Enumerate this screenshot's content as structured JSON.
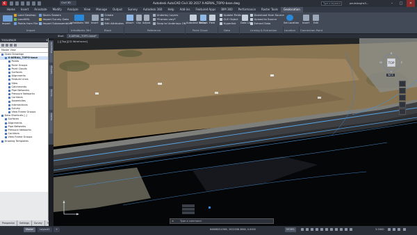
{
  "title_bar": {
    "app_icon_letter": "C",
    "workspace": "Civil 3D",
    "window_title": "Autodesk AutoCAD Civil 3D 2017    X-AERIAL_TOPO-base.dwg",
    "search_placeholder": "Type a keyword",
    "user_name": "paulslaughs3...",
    "minimize": "–",
    "maximize": "□",
    "close": "✕"
  },
  "ribbon_tabs": [
    "Home",
    "Insert",
    "Annotate",
    "Modify",
    "Analyze",
    "View",
    "Manage",
    "Output",
    "Survey",
    "Autodesk 360",
    "Help",
    "Add-ins",
    "Featured Apps",
    "BIM 360",
    "Performance",
    "Raster Tools",
    "Geolocation"
  ],
  "active_tab": "Geolocation",
  "ribbon": {
    "import_label": "Import",
    "import_items": [
      "Land Desktop",
      "LandXML",
      "Points from File"
    ],
    "import_items_2": [
      "Storm Sewers",
      "Import Survey Data",
      "Import Subassemblies"
    ],
    "infraworks_label": "InfraWorks 360",
    "insert_label": "Insert",
    "block_items": [
      "Create",
      "Edit",
      "Edit Attributes"
    ],
    "reference_items": [
      "Attach",
      "Clip",
      "Adjust"
    ],
    "reference_items_2": [
      "Underlay Layers",
      "*Frames vary*",
      "Snap to Underlays ON"
    ],
    "autodesk_recap_label": "Autodesk ReCap",
    "pointcloud_attach_label": "Attach",
    "pointcloud_field_label": "Field",
    "data_items": [
      "Update Fields",
      "OLE Object",
      "Hyperlink"
    ],
    "data_link_label": "Data Link",
    "linking_items": [
      "Download from Source",
      "Upload to Source",
      "Extract Data"
    ],
    "set_location_label": "Set Location",
    "connection_insert_label": "Insert",
    "connection_edit_label": "Edit",
    "panels": [
      "Import",
      "InfraWorks 360",
      "Block",
      "Reference",
      "Point Cloud",
      "Data",
      "Linking & Extraction",
      "Location",
      "Connection Point"
    ]
  },
  "doc_tabs": [
    "Start",
    "X-AERIAL_TOPO-base*"
  ],
  "active_doc": "X-AERIAL_TOPO-base*",
  "toolspace": {
    "title": "TOOLSPACE",
    "selector": "Master View",
    "tree": [
      {
        "label": "Open Drawings",
        "level": 0
      },
      {
        "label": "X-AERIAL_TOPO-base",
        "level": 1,
        "bold": true,
        "selected": true
      },
      {
        "label": "Points",
        "level": 2
      },
      {
        "label": "Point Groups",
        "level": 2
      },
      {
        "label": "Point Clouds",
        "level": 2
      },
      {
        "label": "Surfaces",
        "level": 2
      },
      {
        "label": "Alignments",
        "level": 2
      },
      {
        "label": "Feature Lines",
        "level": 2
      },
      {
        "label": "Sites",
        "level": 2
      },
      {
        "label": "Catchments",
        "level": 2
      },
      {
        "label": "Pipe Networks",
        "level": 2
      },
      {
        "label": "Pressure Networks",
        "level": 2
      },
      {
        "label": "Corridors",
        "level": 2
      },
      {
        "label": "Assemblies",
        "level": 2
      },
      {
        "label": "Intersections",
        "level": 2
      },
      {
        "label": "Survey",
        "level": 2
      },
      {
        "label": "View Frame Groups",
        "level": 2
      },
      {
        "label": "Data Shortcuts [-]",
        "level": 0
      },
      {
        "label": "Surfaces",
        "level": 1
      },
      {
        "label": "Alignments",
        "level": 1
      },
      {
        "label": "Pipe Networks",
        "level": 1
      },
      {
        "label": "Pressure Networks",
        "level": 1
      },
      {
        "label": "Corridors",
        "level": 1
      },
      {
        "label": "View Frame Groups",
        "level": 1
      },
      {
        "label": "Drawing Templates",
        "level": 0
      }
    ],
    "side_tabs": [
      "Prospector",
      "Settings",
      "Survey",
      "Toolbox"
    ]
  },
  "viewport": {
    "label": "[-][Top][2D Wireframe]",
    "viewcube_label": "TOP",
    "compass_n": "N",
    "compass_s": "S",
    "compass_e": "E",
    "compass_w": "W",
    "wcs_label": "WCS"
  },
  "command_line": {
    "placeholder": "Type a command",
    "close": "×"
  },
  "status_bar": {
    "layout_tabs": [
      "Model",
      "Layout1",
      "+"
    ],
    "active_layout": "Model",
    "coordinates": "6466803.0360, 2022036.3860, 0.0000",
    "model_label": "MODEL",
    "scale": "1:5000",
    "value": "3.5000"
  },
  "colors": {
    "ribbon_bg": "#434a57",
    "title_bg": "#2b2f37",
    "viewport_bg": "#000000",
    "road_line": "#58a6e8",
    "accent": "#2b88d8"
  }
}
